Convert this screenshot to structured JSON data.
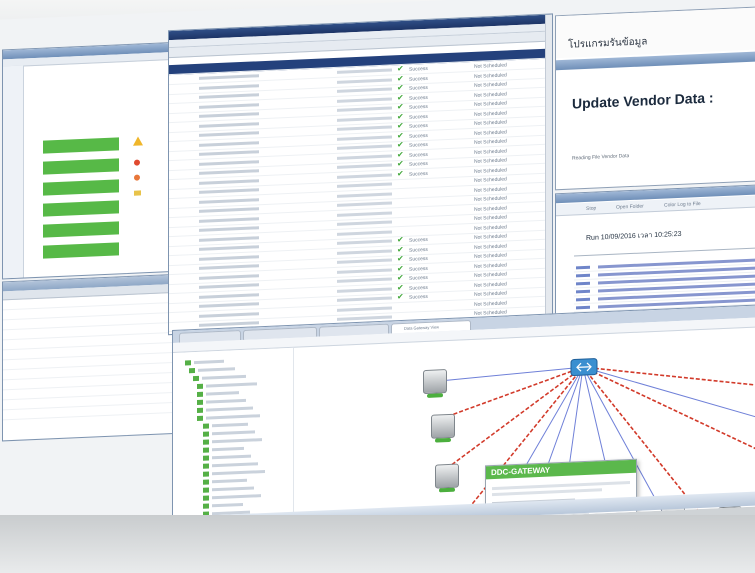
{
  "vendor_panel": {
    "thai_heading": "โปรแกรมรันข้อมูล",
    "title": "Update Vendor Data :",
    "status": "Reading File Vendor Data"
  },
  "log_panel": {
    "toolbar": [
      "Stop",
      "Open Folder",
      "Color Log to File"
    ],
    "run_label": "Run 10/09/2016  เวลา 10:25:23"
  },
  "browser": {
    "active_tab": "Data Gateway View"
  },
  "network": {
    "gateway_popup_title": "DDC-GATEWAY"
  },
  "job_list": {
    "status_column": [
      "Success",
      "Not Scheduled"
    ]
  },
  "icons": [
    "check-icon",
    "server-icon",
    "folder-icon",
    "warning-icon",
    "router-icon"
  ],
  "colors": {
    "accent_green": "#57b947",
    "selection_blue": "#24417c",
    "link_red": "#d23a2a",
    "link_blue": "#6f80d8"
  }
}
